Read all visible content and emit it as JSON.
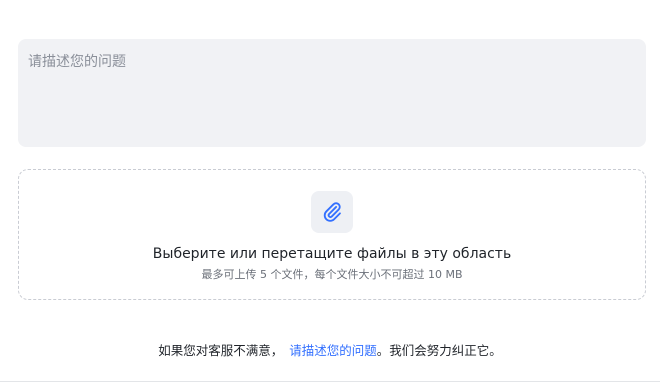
{
  "feedback": {
    "placeholder": "请描述您的问题",
    "value": ""
  },
  "upload": {
    "title": "Выберите или перетащите файлы в эту область",
    "hint": "最多可上传 5 个文件，每个文件大小不可超过 10 MB",
    "icon": "paperclip-icon",
    "icon_color": "#3370ff"
  },
  "footer": {
    "prefix": "如果您对客服不满意，",
    "link": "请描述您的问题",
    "suffix": "。我们会努力纠正它。",
    "link_color": "#3370ff"
  }
}
